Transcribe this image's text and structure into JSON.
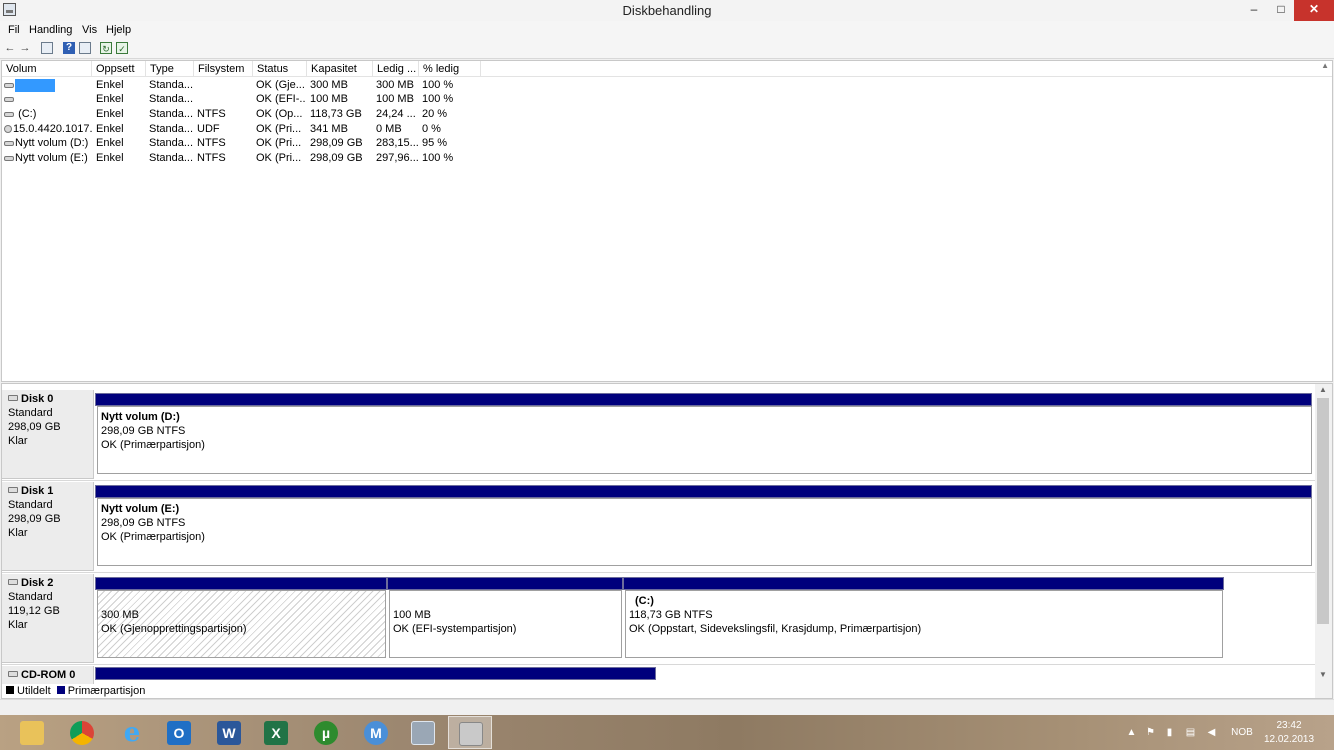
{
  "window": {
    "title": "Diskbehandling",
    "min": "–",
    "max": "□",
    "close": "✕"
  },
  "menu": [
    "Fil",
    "Handling",
    "Vis",
    "Hjelp"
  ],
  "toolbar": {
    "back": "←",
    "forward": "→",
    "help": "?"
  },
  "list": {
    "headers": [
      "Volum",
      "Oppsett",
      "Type",
      "Filsystem",
      "Status",
      "Kapasitet",
      "Ledig ...",
      "% ledig"
    ],
    "rows": [
      {
        "volume": "",
        "layout": "Enkel",
        "type": "Standa...",
        "fs": "",
        "status": "OK (Gje...",
        "capacity": "300 MB",
        "free": "300 MB",
        "pct": "100 %"
      },
      {
        "volume": "",
        "layout": "Enkel",
        "type": "Standa...",
        "fs": "",
        "status": "OK (EFI-...",
        "capacity": "100 MB",
        "free": "100 MB",
        "pct": "100 %"
      },
      {
        "volume": "(C:)",
        "layout": "Enkel",
        "type": "Standa...",
        "fs": "NTFS",
        "status": "OK (Op...",
        "capacity": "118,73 GB",
        "free": "24,24 ...",
        "pct": "20 %"
      },
      {
        "volume": "15.0.4420.1017...",
        "layout": "Enkel",
        "type": "Standa...",
        "fs": "UDF",
        "status": "OK (Pri...",
        "capacity": "341 MB",
        "free": "0 MB",
        "pct": "0 %"
      },
      {
        "volume": "Nytt volum (D:)",
        "layout": "Enkel",
        "type": "Standa...",
        "fs": "NTFS",
        "status": "OK (Pri...",
        "capacity": "298,09 GB",
        "free": "283,15...",
        "pct": "95 %"
      },
      {
        "volume": "Nytt volum (E:)",
        "layout": "Enkel",
        "type": "Standa...",
        "fs": "NTFS",
        "status": "OK (Pri...",
        "capacity": "298,09 GB",
        "free": "297,96...",
        "pct": "100 %"
      }
    ]
  },
  "disks": [
    {
      "name": "Disk 0",
      "kind": "Standard",
      "size": "298,09 GB",
      "state": "Klar",
      "partitions": [
        {
          "name": "Nytt volum  (D:)",
          "size": "298,09 GB NTFS",
          "status": "OK (Primærpartisjon)"
        }
      ]
    },
    {
      "name": "Disk 1",
      "kind": "Standard",
      "size": "298,09 GB",
      "state": "Klar",
      "partitions": [
        {
          "name": "Nytt volum  (E:)",
          "size": "298,09 GB NTFS",
          "status": "OK (Primærpartisjon)"
        }
      ]
    },
    {
      "name": "Disk 2",
      "kind": "Standard",
      "size": "119,12 GB",
      "state": "Klar",
      "partitions": [
        {
          "name": "",
          "size": "300 MB",
          "status": "OK (Gjenopprettingspartisjon)"
        },
        {
          "name": "",
          "size": "100 MB",
          "status": "OK (EFI-systempartisjon)"
        },
        {
          "name": "(C:)",
          "size": "118,73 GB NTFS",
          "status": "OK (Oppstart, Sidevekslingsfil, Krasjdump, Primærpartisjon)"
        }
      ]
    },
    {
      "name": "CD-ROM 0"
    }
  ],
  "legend": {
    "unallocated": "Utildelt",
    "primary": "Primærpartisjon",
    "unallocated_color": "#000000",
    "primary_color": "#00007c"
  },
  "taskbar": {
    "apps": [
      "file-explorer-icon",
      "chrome-icon",
      "internet-explorer-icon",
      "outlook-icon",
      "word-icon",
      "excel-icon",
      "utorrent-icon",
      "maxthon-icon",
      "calculator-icon",
      "disk-management-icon"
    ],
    "app_letters": [
      "",
      "",
      "e",
      "O",
      "W",
      "X",
      "µ",
      "M",
      "",
      ""
    ],
    "lang": "NOB",
    "time": "23:42",
    "date": "12.02.2013"
  }
}
